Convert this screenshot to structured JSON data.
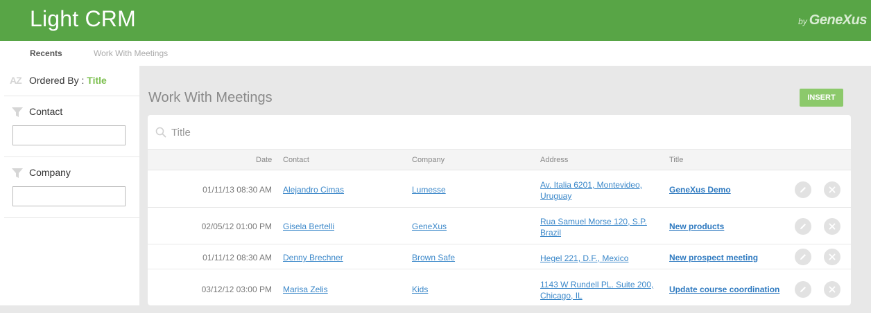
{
  "header": {
    "title": "Light CRM",
    "brand_by": "by",
    "brand_name": "GeneXus",
    "color": "#58a546"
  },
  "breadcrumb": [
    "Recents",
    "Work With Meetings"
  ],
  "sidebar": {
    "az_icon": "AZ",
    "ordered_label": "Ordered By :",
    "ordered_value": "Title",
    "filters": [
      {
        "label": "Contact",
        "icon": "funnel-icon",
        "value": ""
      },
      {
        "label": "Company",
        "icon": "funnel-icon",
        "value": ""
      }
    ]
  },
  "main": {
    "title": "Work With Meetings",
    "insert_label": "INSERT",
    "search_placeholder": "Title",
    "columns": [
      "Date",
      "Contact",
      "Company",
      "Address",
      "Title"
    ],
    "rows": [
      {
        "date": "01/11/13 08:30 AM",
        "contact": "Alejandro Cimas",
        "company": "Lumesse",
        "address_1": "Av. Italia 6201, Montevideo,",
        "address_2": "Uruguay",
        "title": "GeneXus Demo"
      },
      {
        "date": "02/05/12 01:00 PM",
        "contact": "Gisela Bertelli",
        "company": "GeneXus",
        "address_1": "Rua Samuel Morse 120, S.P.",
        "address_2": "Brazil",
        "title": "New products"
      },
      {
        "date": "01/11/12 08:30 AM",
        "contact": "Denny Brechner",
        "company": "Brown Safe",
        "address_1": "Hegel 221, D.F., Mexico",
        "address_2": "",
        "title": "New prospect meeting"
      },
      {
        "date": "03/12/12 03:00 PM",
        "contact": "Marisa Zelis",
        "company": "Kids",
        "address_1": "1143 W Rundell PL. Suite 200,",
        "address_2": "Chicago, IL",
        "title": "Update course coordination"
      }
    ]
  },
  "colors": {
    "accent": "#58a546",
    "insert": "#8cc96b",
    "link": "#3a87c9",
    "ordered_value": "#7cbf4f"
  }
}
